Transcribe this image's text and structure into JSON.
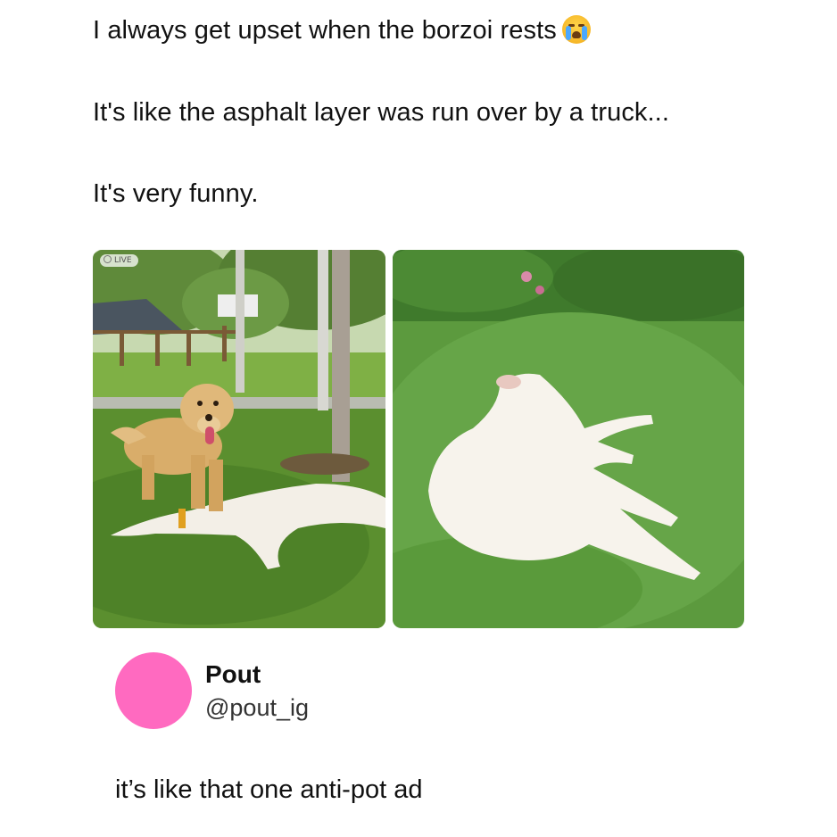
{
  "post": {
    "lines": [
      "I always get upset when the borzoi rests",
      "It's like the asphalt layer was run over by a truck...",
      "It's very funny."
    ],
    "emoji": "loudly-crying-face-icon",
    "photos": [
      {
        "badge": "LIVE"
      }
    ]
  },
  "reply": {
    "display_name": "Pout",
    "handle": "@pout_ig",
    "text": "it’s like that one anti-pot ad",
    "avatar_color": "#ff6ac0"
  }
}
